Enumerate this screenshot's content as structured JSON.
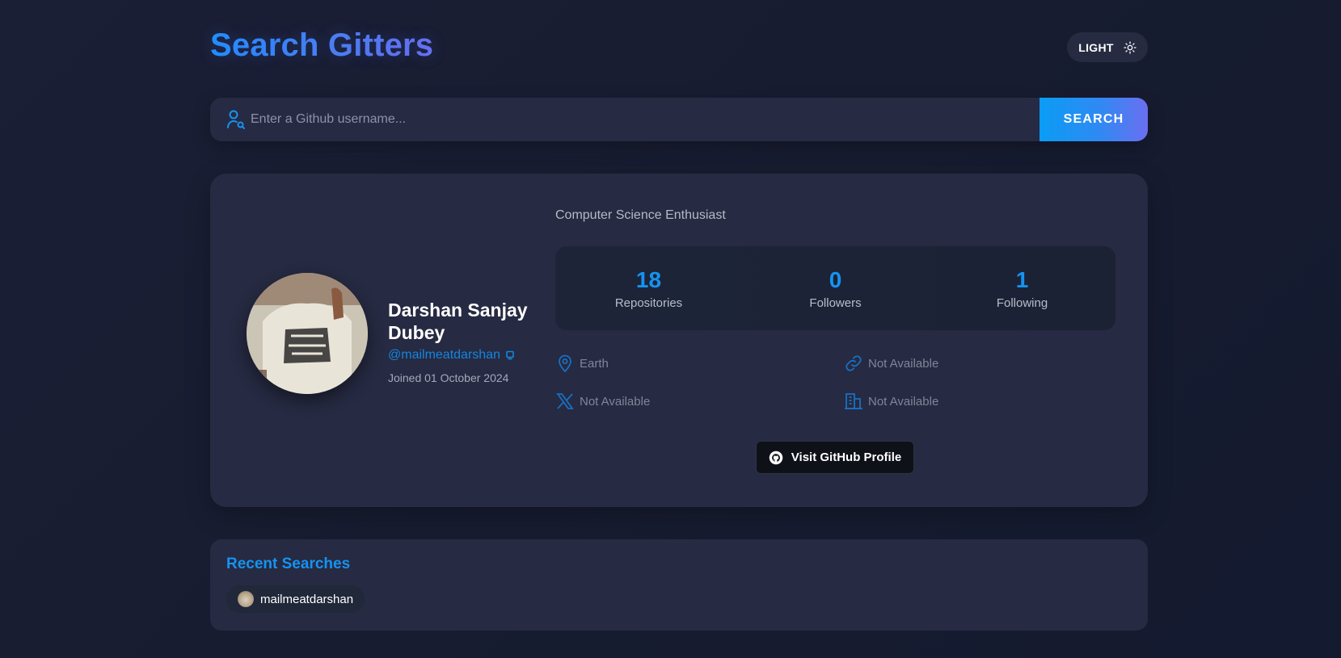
{
  "header": {
    "title": "Search Gitters",
    "theme_toggle_label": "LIGHT"
  },
  "search": {
    "placeholder": "Enter a Github username...",
    "value": "",
    "button_label": "SEARCH"
  },
  "profile": {
    "name": "Darshan Sanjay Dubey",
    "login": "@mailmeatdarshan",
    "joined": "Joined 01 October 2024",
    "bio": "Computer Science Enthusiast",
    "stats": [
      {
        "value": "18",
        "label": "Repositories"
      },
      {
        "value": "0",
        "label": "Followers"
      },
      {
        "value": "1",
        "label": "Following"
      }
    ],
    "location": "Earth",
    "blog": "Not Available",
    "twitter": "Not Available",
    "company": "Not Available",
    "visit_button_label": "Visit GitHub Profile"
  },
  "recent": {
    "title": "Recent Searches",
    "items": [
      {
        "username": "mailmeatdarshan"
      }
    ]
  },
  "colors": {
    "accent": "#1593f0",
    "background": "#171c30",
    "card": "#262a42"
  }
}
